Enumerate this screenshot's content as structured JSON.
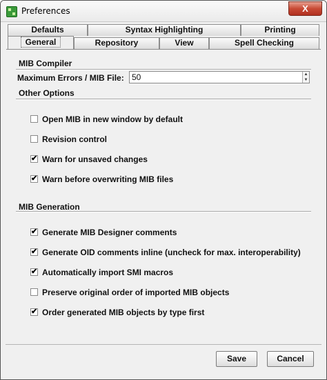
{
  "window": {
    "title": "Preferences",
    "close_label": "X"
  },
  "tabs": {
    "row1": [
      {
        "label": "Defaults"
      },
      {
        "label": "Syntax Highlighting"
      },
      {
        "label": "Printing"
      }
    ],
    "row2": [
      {
        "label": "General",
        "active": true
      },
      {
        "label": "Repository"
      },
      {
        "label": "View"
      },
      {
        "label": "Spell Checking"
      }
    ]
  },
  "mib_compiler": {
    "heading": "MIB Compiler",
    "max_errors_label": "Maximum Errors / MIB File:",
    "max_errors_value": "50"
  },
  "other_options": {
    "heading": "Other Options",
    "items": [
      {
        "label": "Open MIB in new window by default",
        "checked": false
      },
      {
        "label": "Revision control",
        "checked": false
      },
      {
        "label": "Warn for unsaved changes",
        "checked": true
      },
      {
        "label": "Warn before overwriting MIB files",
        "checked": true
      }
    ]
  },
  "mib_generation": {
    "heading": "MIB Generation",
    "items": [
      {
        "label": "Generate MIB Designer comments",
        "checked": true
      },
      {
        "label": "Generate OID comments inline (uncheck for max. interoperability)",
        "checked": true
      },
      {
        "label": "Automatically import SMI macros",
        "checked": true
      },
      {
        "label": "Preserve original order of imported MIB objects",
        "checked": false
      },
      {
        "label": "Order generated MIB objects by type first",
        "checked": true
      }
    ]
  },
  "buttons": {
    "save": "Save",
    "cancel": "Cancel"
  }
}
